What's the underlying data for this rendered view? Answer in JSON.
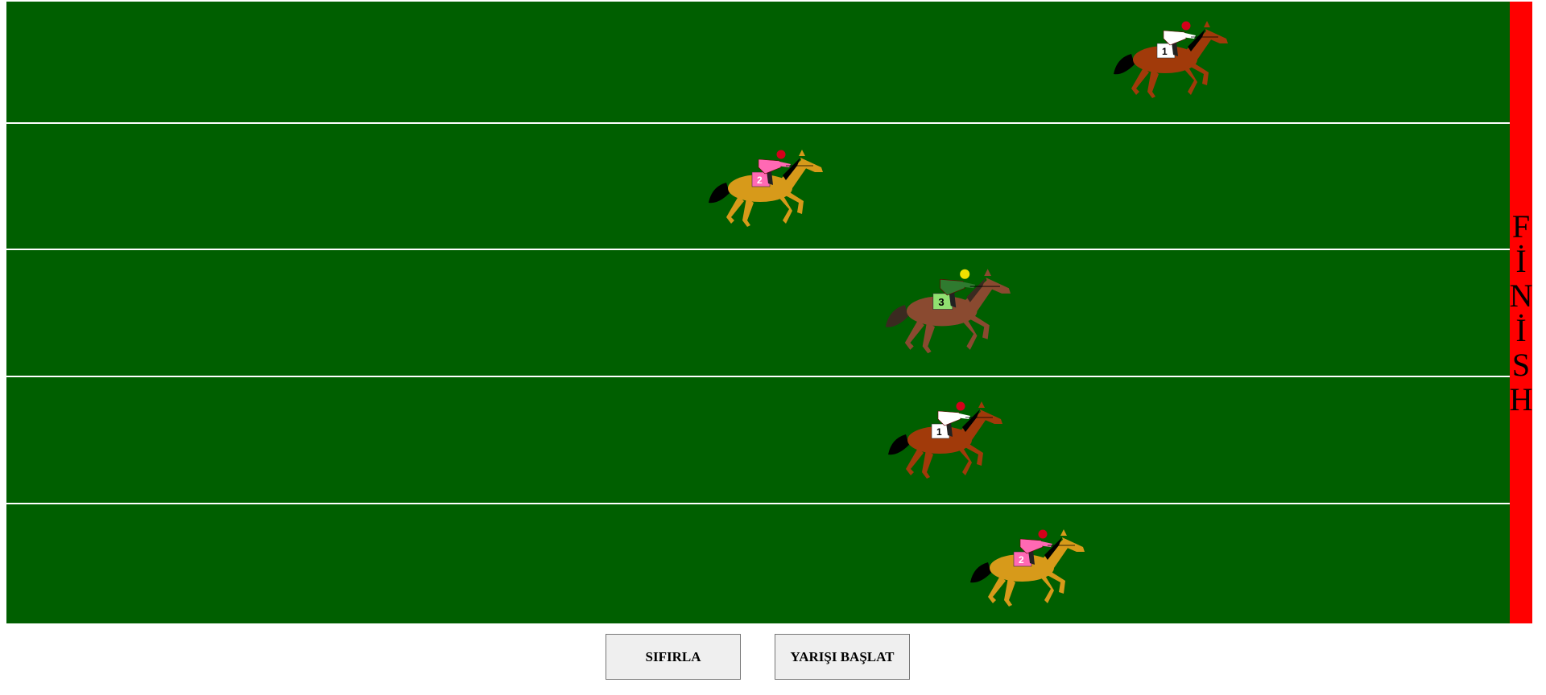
{
  "finish": {
    "letters": [
      "F",
      "İ",
      "N",
      "İ",
      "S",
      "H"
    ],
    "color": "#ff0000"
  },
  "track": {
    "color": "#005f00",
    "divider_color": "#ffffff"
  },
  "horses": [
    {
      "number": "1",
      "style": "chestnut"
    },
    {
      "number": "2",
      "style": "palomino"
    },
    {
      "number": "3",
      "style": "bay"
    },
    {
      "number": "1",
      "style": "chestnut"
    },
    {
      "number": "2",
      "style": "palomino"
    }
  ],
  "controls": {
    "reset_label": "SIFIRLA",
    "start_label": "YARIŞI BAŞLAT"
  }
}
